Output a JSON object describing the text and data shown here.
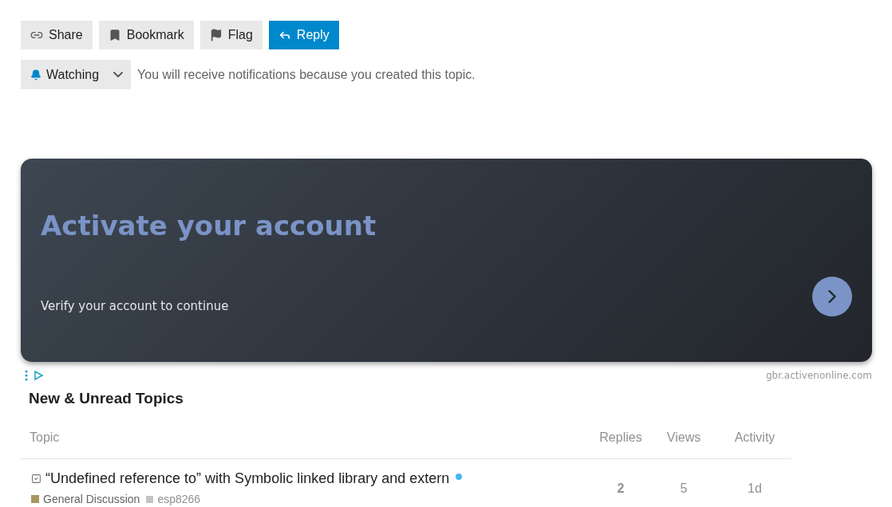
{
  "actions": [
    {
      "label": "Share",
      "kind": "share",
      "primary": false
    },
    {
      "label": "Bookmark",
      "kind": "bookmark",
      "primary": false
    },
    {
      "label": "Flag",
      "kind": "flag",
      "primary": false
    },
    {
      "label": "Reply",
      "kind": "reply",
      "primary": true
    }
  ],
  "notification": {
    "level": "Watching",
    "reason": "You will receive notifications because you created this topic."
  },
  "ad": {
    "title": "Activate your account",
    "subtitle": "Verify your account to continue",
    "domain": "gbr.activenonline.com"
  },
  "topics_section": {
    "heading": "New & Unread Topics",
    "columns": [
      "Topic",
      "Replies",
      "Views",
      "Activity"
    ],
    "rows": [
      {
        "title": "“Undefined reference to” with Symbolic linked library and extern",
        "solved": true,
        "unread": true,
        "category": {
          "name": "General Discussion",
          "color": "#a99561"
        },
        "tags": [
          {
            "name": "esp8266",
            "color": "#c4c4c4"
          }
        ],
        "replies": "2",
        "views": "5",
        "activity": "1d"
      }
    ]
  }
}
